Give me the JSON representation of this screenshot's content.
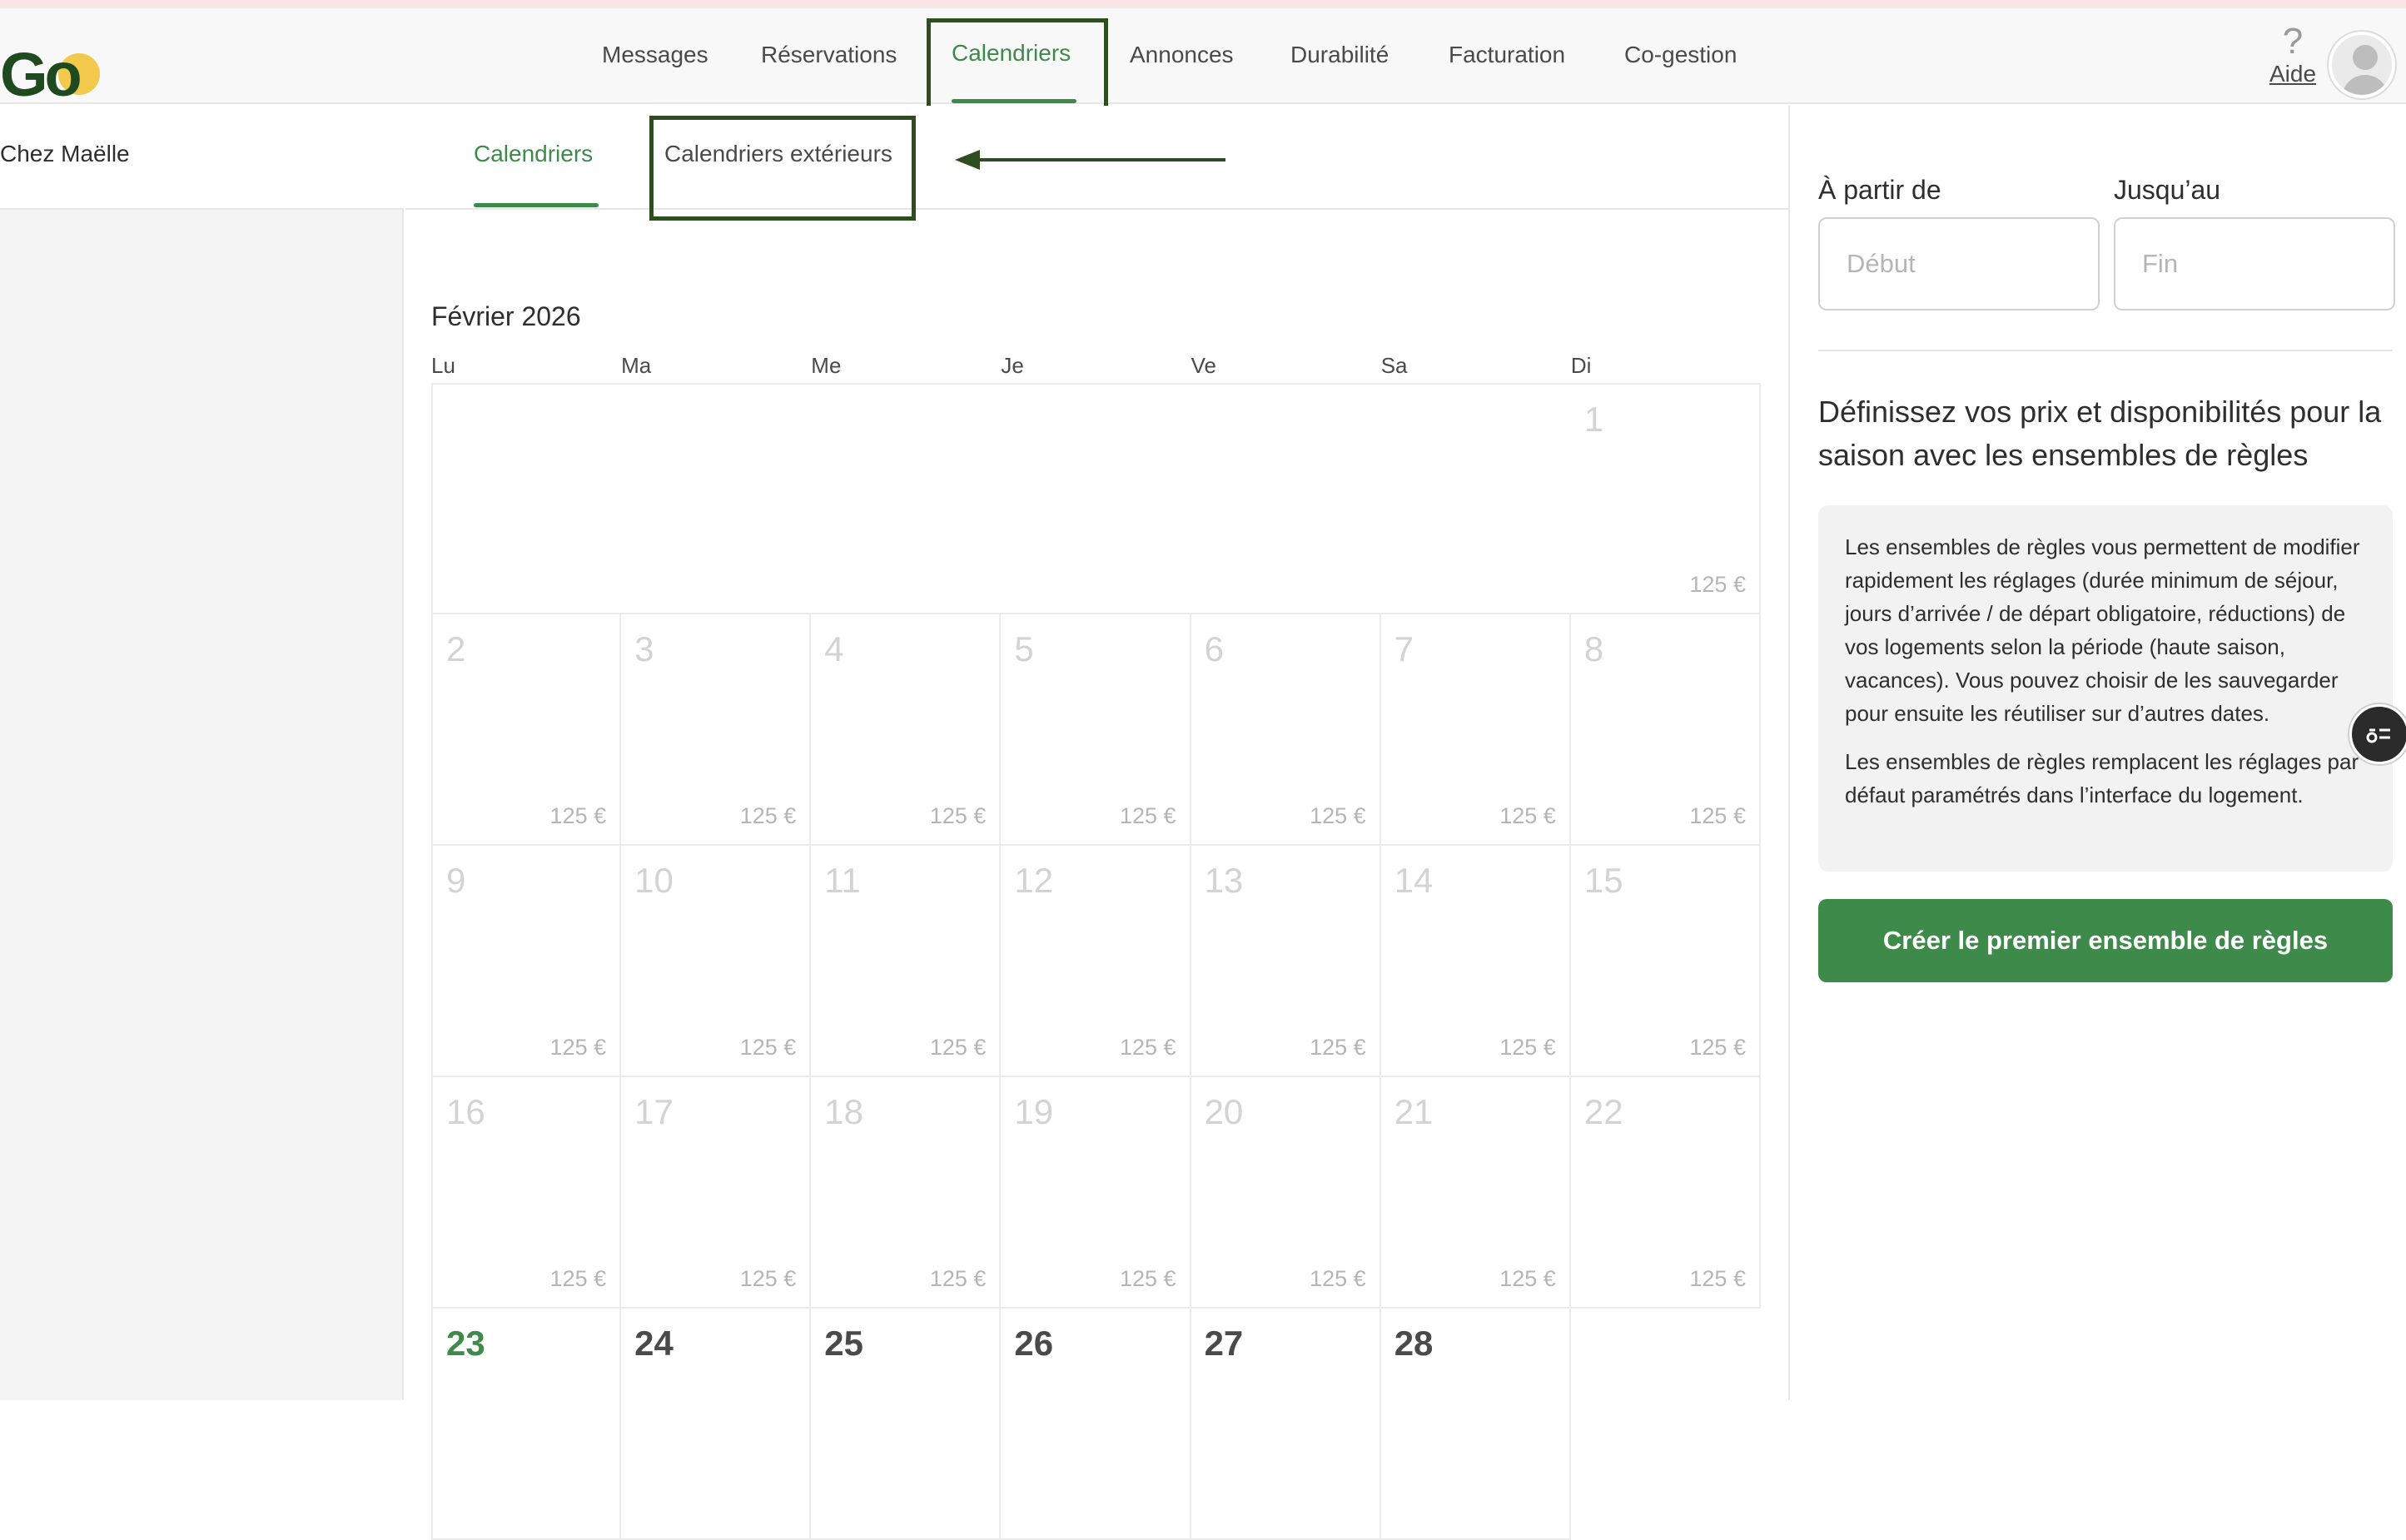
{
  "header": {
    "logo_text": "Go",
    "nav": [
      {
        "label": "Messages"
      },
      {
        "label": "Réservations"
      },
      {
        "label": "Calendriers",
        "active": true
      },
      {
        "label": "Annonces"
      },
      {
        "label": "Durabilité"
      },
      {
        "label": "Facturation"
      },
      {
        "label": "Co-gestion"
      }
    ],
    "help_glyph": "?",
    "help_label": "Aide",
    "avatar_icon": "user-avatar-icon"
  },
  "sidebar": {
    "property_name": "Chez Maëlle"
  },
  "subtabs": [
    {
      "label": "Calendriers",
      "active": true
    },
    {
      "label": "Calendriers extérieurs",
      "active": false
    }
  ],
  "calendar": {
    "month_title": "Février 2026",
    "weekdays": [
      "Lu",
      "Ma",
      "Me",
      "Je",
      "Ve",
      "Sa",
      "Di"
    ],
    "first_weekday_index": 6,
    "days": [
      {
        "day": "1",
        "price": "125 €",
        "state": "past"
      },
      {
        "day": "2",
        "price": "125 €",
        "state": "past"
      },
      {
        "day": "3",
        "price": "125 €",
        "state": "past"
      },
      {
        "day": "4",
        "price": "125 €",
        "state": "past"
      },
      {
        "day": "5",
        "price": "125 €",
        "state": "past"
      },
      {
        "day": "6",
        "price": "125 €",
        "state": "past"
      },
      {
        "day": "7",
        "price": "125 €",
        "state": "past"
      },
      {
        "day": "8",
        "price": "125 €",
        "state": "past"
      },
      {
        "day": "9",
        "price": "125 €",
        "state": "past"
      },
      {
        "day": "10",
        "price": "125 €",
        "state": "past"
      },
      {
        "day": "11",
        "price": "125 €",
        "state": "past"
      },
      {
        "day": "12",
        "price": "125 €",
        "state": "past"
      },
      {
        "day": "13",
        "price": "125 €",
        "state": "past"
      },
      {
        "day": "14",
        "price": "125 €",
        "state": "past"
      },
      {
        "day": "15",
        "price": "125 €",
        "state": "past"
      },
      {
        "day": "16",
        "price": "125 €",
        "state": "past"
      },
      {
        "day": "17",
        "price": "125 €",
        "state": "past"
      },
      {
        "day": "18",
        "price": "125 €",
        "state": "past"
      },
      {
        "day": "19",
        "price": "125 €",
        "state": "past"
      },
      {
        "day": "20",
        "price": "125 €",
        "state": "past"
      },
      {
        "day": "21",
        "price": "125 €",
        "state": "past"
      },
      {
        "day": "22",
        "price": "125 €",
        "state": "past"
      },
      {
        "day": "23",
        "price": "",
        "state": "today"
      },
      {
        "day": "24",
        "price": "",
        "state": "future"
      },
      {
        "day": "25",
        "price": "",
        "state": "future"
      },
      {
        "day": "26",
        "price": "",
        "state": "future"
      },
      {
        "day": "27",
        "price": "",
        "state": "future"
      },
      {
        "day": "28",
        "price": "",
        "state": "future"
      }
    ]
  },
  "rules_panel": {
    "from_label": "À partir de",
    "from_placeholder": "Début",
    "to_label": "Jusqu’au",
    "to_placeholder": "Fin",
    "heading": "Définissez vos prix et disponibilités pour la saison avec les ensembles de règles",
    "info_paragraph_1": "Les ensembles de règles vous permettent de modifier rapidement les réglages (durée minimum de séjour, jours d’arrivée / de départ obligatoire, réductions) de vos logements selon la période (haute saison, vacances). Vous pouvez choisir de les sauvegarder pour ensuite les réutiliser sur d’autres dates.",
    "info_paragraph_2": "Les ensembles de règles remplacent les réglages par défaut paramétrés dans l’interface du logement.",
    "cta_label": "Créer le premier ensemble de règles"
  },
  "floating_button": {
    "icon": "rules-list-icon"
  },
  "colors": {
    "accent_green": "#3e8a4a",
    "annotation_box": "#2e4e22",
    "logo_dark": "#1f4a1f",
    "logo_dot": "#f2c94c"
  }
}
